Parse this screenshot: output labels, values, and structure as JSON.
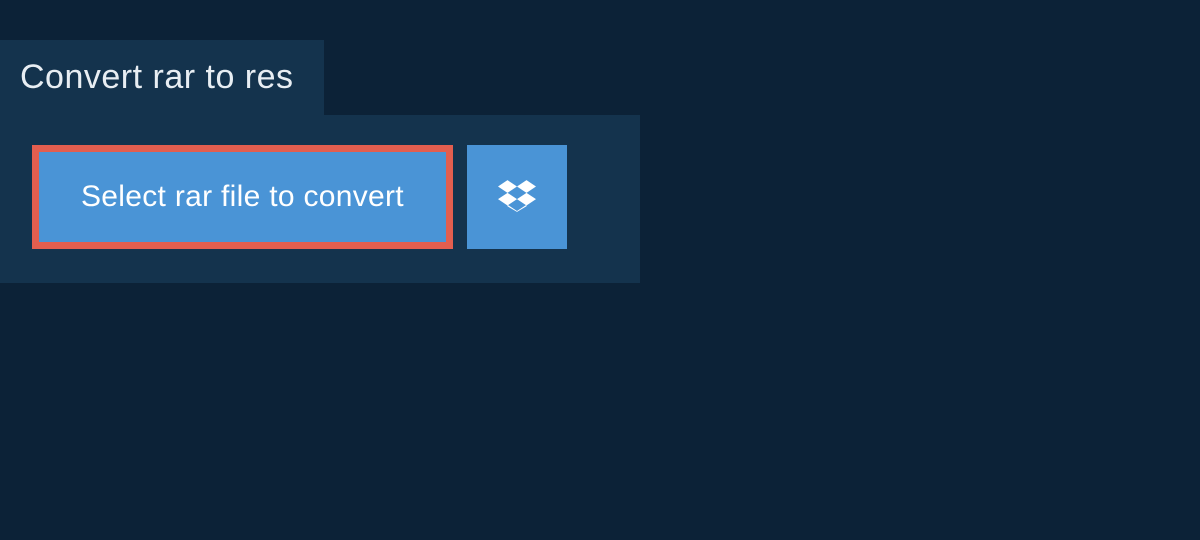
{
  "tab": {
    "title": "Convert rar to res"
  },
  "actions": {
    "select_file_label": "Select rar file to convert"
  },
  "icons": {
    "dropbox": "dropbox-icon"
  }
}
